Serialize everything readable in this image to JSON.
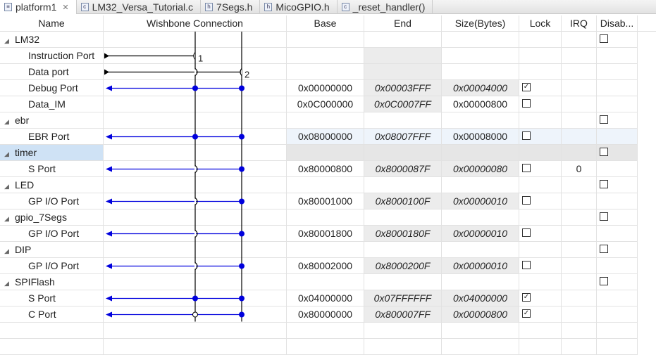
{
  "tabs": [
    {
      "label": "platform1",
      "icon": "file-icon",
      "active": true
    },
    {
      "label": "LM32_Versa_Tutorial.c",
      "icon": "c-file-icon"
    },
    {
      "label": "7Segs.h",
      "icon": "h-file-icon"
    },
    {
      "label": "MicoGPIO.h",
      "icon": "h-file-icon"
    },
    {
      "label": "_reset_handler()",
      "icon": "c-file-icon"
    }
  ],
  "columns": [
    "Name",
    "Wishbone Connection",
    "Base",
    "End",
    "Size(Bytes)",
    "Lock",
    "IRQ",
    "Disab..."
  ],
  "bus_labels": [
    "1",
    "2"
  ],
  "colors": {
    "slave_line": "#0000dd",
    "master_line": "#000000",
    "selection": "#cfe2f5"
  },
  "rows": [
    {
      "type": "group",
      "name": "LM32",
      "disable": false
    },
    {
      "type": "port",
      "name": "Instruction Port",
      "conn": "master",
      "bus": 1
    },
    {
      "type": "port",
      "name": "Data port",
      "conn": "master",
      "bus": 2
    },
    {
      "type": "port",
      "name": "Debug Port",
      "conn": "slave",
      "m1": "dot",
      "m2": "dot",
      "base": "0x00000000",
      "end": "0x00003FFF",
      "size": "0x00004000",
      "size_editable": false,
      "lock": true
    },
    {
      "type": "port",
      "name": "Data_IM",
      "conn": "none",
      "base": "0x0C000000",
      "end": "0x0C0007FF",
      "size": "0x00000800",
      "size_editable": true,
      "lock": false
    },
    {
      "type": "group",
      "name": "ebr",
      "disable": false
    },
    {
      "type": "port",
      "name": "EBR Port",
      "conn": "slave",
      "m1": "dot",
      "m2": "dot",
      "base": "0x08000000",
      "end": "0x08007FFF",
      "size": "0x00008000",
      "size_editable": true,
      "lock": false,
      "highlight": true
    },
    {
      "type": "group",
      "name": "timer",
      "disable": false,
      "selected": true
    },
    {
      "type": "port",
      "name": "S Port",
      "conn": "slave",
      "m1": "hop",
      "m2": "dot",
      "base": "0x80000800",
      "end": "0x8000087F",
      "size": "0x00000080",
      "size_editable": false,
      "lock": false,
      "irq": "0"
    },
    {
      "type": "group",
      "name": "LED",
      "disable": false
    },
    {
      "type": "port",
      "name": "GP I/O Port",
      "conn": "slave",
      "m1": "hop",
      "m2": "dot",
      "base": "0x80001000",
      "end": "0x8000100F",
      "size": "0x00000010",
      "size_editable": false,
      "lock": false
    },
    {
      "type": "group",
      "name": "gpio_7Segs",
      "disable": false
    },
    {
      "type": "port",
      "name": "GP I/O Port",
      "conn": "slave",
      "m1": "hop",
      "m2": "dot",
      "base": "0x80001800",
      "end": "0x8000180F",
      "size": "0x00000010",
      "size_editable": false,
      "lock": false
    },
    {
      "type": "group",
      "name": "DIP",
      "disable": false
    },
    {
      "type": "port",
      "name": "GP I/O Port",
      "conn": "slave",
      "m1": "hop",
      "m2": "dot",
      "base": "0x80002000",
      "end": "0x8000200F",
      "size": "0x00000010",
      "size_editable": false,
      "lock": false
    },
    {
      "type": "group",
      "name": "SPIFlash",
      "disable": false
    },
    {
      "type": "port",
      "name": "S Port",
      "conn": "slave",
      "m1": "dot",
      "m2": "dot",
      "base": "0x04000000",
      "end": "0x07FFFFFF",
      "size": "0x04000000",
      "size_editable": false,
      "lock": true
    },
    {
      "type": "port",
      "name": "C Port",
      "conn": "slave",
      "m1": "hollow",
      "m2": "dot",
      "base": "0x80000000",
      "end": "0x800007FF",
      "size": "0x00000800",
      "size_editable": false,
      "lock": true
    }
  ]
}
